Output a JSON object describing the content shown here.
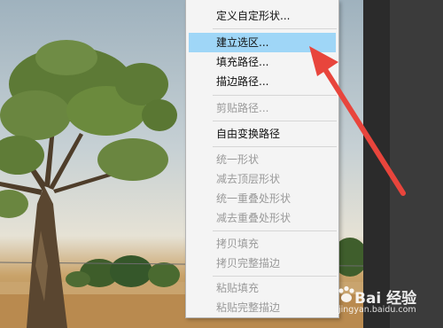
{
  "context_menu": {
    "items": [
      {
        "label": "定义自定形状...",
        "enabled": true,
        "selected": false
      },
      {
        "label": "建立选区...",
        "enabled": true,
        "selected": true
      },
      {
        "label": "填充路径...",
        "enabled": true,
        "selected": false
      },
      {
        "label": "描边路径...",
        "enabled": true,
        "selected": false
      },
      {
        "label": "剪贴路径...",
        "enabled": false,
        "selected": false
      },
      {
        "label": "自由变换路径",
        "enabled": true,
        "selected": false
      },
      {
        "label": "统一形状",
        "enabled": false,
        "selected": false
      },
      {
        "label": "减去顶层形状",
        "enabled": false,
        "selected": false
      },
      {
        "label": "统一重叠处形状",
        "enabled": false,
        "selected": false
      },
      {
        "label": "减去重叠处形状",
        "enabled": false,
        "selected": false
      },
      {
        "label": "拷贝填充",
        "enabled": false,
        "selected": false
      },
      {
        "label": "拷贝完整描边",
        "enabled": false,
        "selected": false
      },
      {
        "label": "粘贴填充",
        "enabled": false,
        "selected": false
      },
      {
        "label": "粘贴完整描边",
        "enabled": false,
        "selected": false
      }
    ]
  },
  "watermark": {
    "brand": "Bai 经验",
    "url": "jingyan.baidu.com"
  },
  "colors": {
    "selection_highlight": "#9fd6f7",
    "arrow": "#e8453c",
    "disabled_text": "#9a9a9a"
  }
}
